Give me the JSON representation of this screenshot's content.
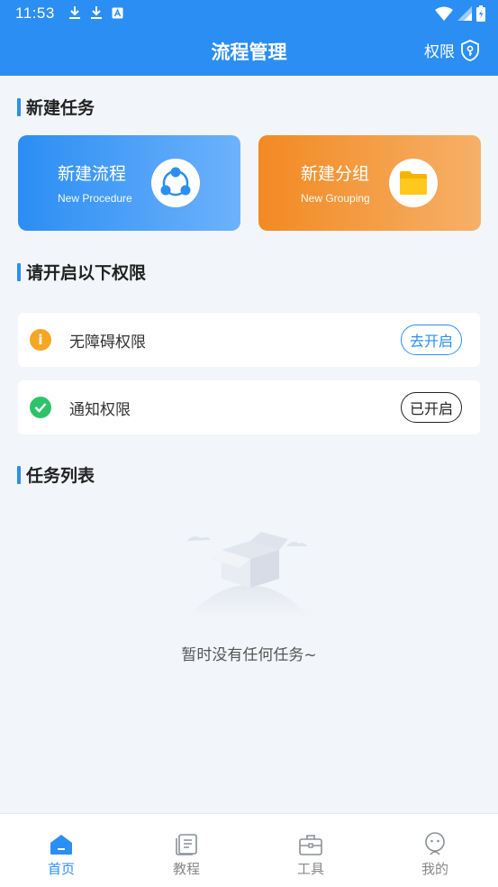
{
  "status_bar": {
    "time": "11:53"
  },
  "header": {
    "title": "流程管理",
    "permission_label": "权限"
  },
  "sections": {
    "new_task": "新建任务",
    "permissions": "请开启以下权限",
    "task_list": "任务列表"
  },
  "cards": [
    {
      "title": "新建流程",
      "subtitle": "New Procedure",
      "icon": "share-nodes-icon"
    },
    {
      "title": "新建分组",
      "subtitle": "New Grouping",
      "icon": "folder-icon"
    }
  ],
  "permissions": [
    {
      "label": "无障碍权限",
      "status_icon": "info-icon",
      "button": "去开启"
    },
    {
      "label": "通知权限",
      "status_icon": "check-icon",
      "button": "已开启"
    }
  ],
  "task_list": {
    "empty_text": "暂时没有任何任务~"
  },
  "tabs": [
    {
      "label": "首页",
      "icon": "home-icon",
      "active": true
    },
    {
      "label": "教程",
      "icon": "book-icon",
      "active": false
    },
    {
      "label": "工具",
      "icon": "toolbox-icon",
      "active": false
    },
    {
      "label": "我的",
      "icon": "user-icon",
      "active": false
    }
  ],
  "colors": {
    "primary": "#2b8ef3",
    "orange": "#f28a22",
    "warning": "#f5a623",
    "success": "#2ec36b"
  }
}
